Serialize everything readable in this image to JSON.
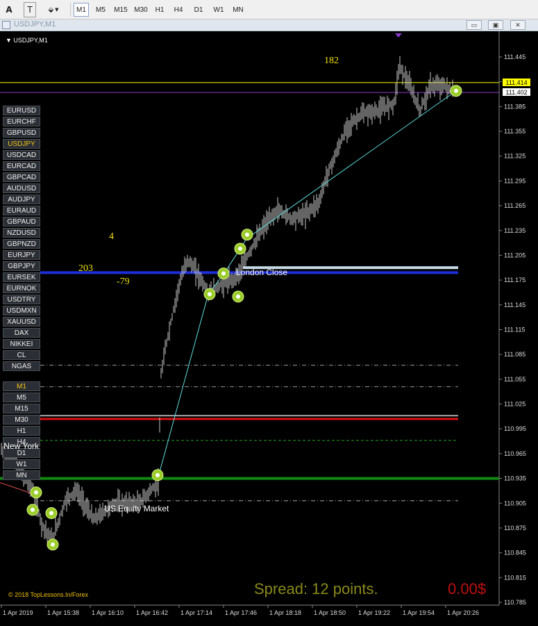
{
  "toolbar": {
    "text_tool": "A",
    "label_tool": "T",
    "shapes_tool": "⬙",
    "timeframes": [
      "M1",
      "M5",
      "M15",
      "M30",
      "H1",
      "H4",
      "D1",
      "W1",
      "MN"
    ],
    "active_timeframe": "M1"
  },
  "window": {
    "title": "USDJPY,M1",
    "minimize": "▭",
    "restore": "▣",
    "close": "✕"
  },
  "chart": {
    "label": "USDJPY,M1",
    "symbols": [
      "EURUSD",
      "EURCHF",
      "GBPUSD",
      "USDJPY",
      "USDCAD",
      "EURCAD",
      "GBPCAD",
      "AUDUSD",
      "AUDJPY",
      "EURAUD",
      "GBPAUD",
      "NZDUSD",
      "GBPNZD",
      "EURJPY",
      "GBPJPY",
      "EURSEK",
      "EURNOK",
      "USDTRY",
      "USDMXN",
      "XAUUSD",
      "DAX",
      "NIKKEI",
      "CL",
      "NGAS"
    ],
    "active_symbol": "USDJPY",
    "timeframes": [
      "M1",
      "M5",
      "M15",
      "M30",
      "H1",
      "H4",
      "D1",
      "W1",
      "MN"
    ],
    "active_timeframe": "M1",
    "price_labels": [
      "111.445",
      "111.415",
      "111.385",
      "111.355",
      "111.325",
      "111.295",
      "111.265",
      "111.235",
      "111.205",
      "111.175",
      "111.145",
      "111.115",
      "111.085",
      "111.055",
      "111.025",
      "110.995",
      "110.965",
      "110.935",
      "110.905",
      "110.875",
      "110.845",
      "110.815",
      "110.785"
    ],
    "time_labels": [
      "1 Apr 2019",
      "1 Apr 15:38",
      "1 Apr 16:10",
      "1 Apr 16:42",
      "1 Apr 17:14",
      "1 Apr 17:46",
      "1 Apr 18:18",
      "1 Apr 18:50",
      "1 Apr 19:22",
      "1 Apr 19:54",
      "1 Apr 20:26"
    ],
    "ask_price": "111.414",
    "bid_price": "111.402",
    "ask_color": "#ffff00",
    "bid_color": "#ffffff",
    "text_182": "182",
    "text_4": "4",
    "text_203": "203",
    "text_79": "-79",
    "london_close": "London Close",
    "us_equity": "US Equity Market",
    "new_york": "New York",
    "spread": "Spread: 12 points.",
    "profit": "0.00$",
    "copyright": "© 2018 TopLessons.In/Forex",
    "ylim": [
      110.785,
      111.445
    ]
  }
}
